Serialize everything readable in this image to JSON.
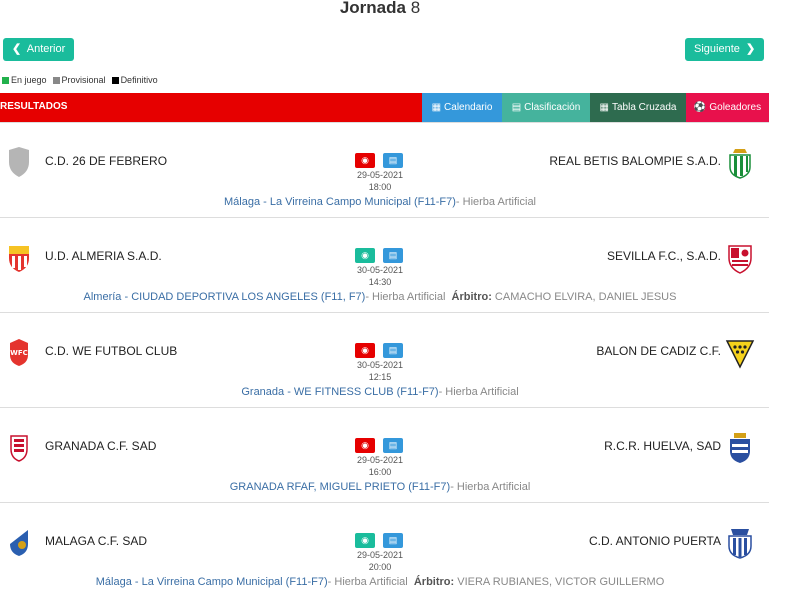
{
  "header": {
    "title_word": "Jornada",
    "title_num": "8"
  },
  "nav": {
    "prev_label": "Anterior",
    "next_label": "Siguiente"
  },
  "legend": [
    {
      "label": "En juego",
      "color": "#22b14c"
    },
    {
      "label": "Provisional",
      "color": "#888888"
    },
    {
      "label": "Definitivo",
      "color": "#000000"
    }
  ],
  "tabs": {
    "section_label": "RESULTADOS",
    "calendario": "Calendario",
    "clasificacion": "Clasificación",
    "tabla": "Tabla Cruzada",
    "goleadores": "Goleadores"
  },
  "matches": [
    {
      "home": "C.D. 26 DE FEBRERO",
      "away": "REAL BETIS BALOMPIE S.A.D.",
      "status": "red",
      "date": "29-05-2021",
      "time": "18:00",
      "location": "Málaga - La Virreina Campo Municipal (F11-F7)",
      "surface": "- Hierba Artificial",
      "ref_label": "",
      "referee": "",
      "home_crest": "shield-gray",
      "away_crest": "betis-crest"
    },
    {
      "home": "U.D. ALMERIA S.A.D.",
      "away": "SEVILLA F.C., S.A.D.",
      "status": "green",
      "date": "30-05-2021",
      "time": "14:30",
      "location": "Almería - CIUDAD DEPORTIVA LOS ANGELES (F11, F7)",
      "surface": "- Hierba Artificial",
      "ref_label": "Árbitro:",
      "referee": "CAMACHO ELVIRA, DANIEL JESUS",
      "home_crest": "almeria-crest",
      "away_crest": "sevilla-crest"
    },
    {
      "home": "C.D. WE FUTBOL CLUB",
      "away": "BALON DE CADIZ C.F.",
      "status": "red",
      "date": "30-05-2021",
      "time": "12:15",
      "location": "Granada - WE FITNESS CLUB (F11-F7)",
      "surface": "- Hierba Artificial",
      "ref_label": "",
      "referee": "",
      "home_crest": "wefc-crest",
      "away_crest": "cadiz-crest"
    },
    {
      "home": "GRANADA C.F. SAD",
      "away": "R.C.R. HUELVA, SAD",
      "status": "red",
      "date": "29-05-2021",
      "time": "16:00",
      "location": "GRANADA RFAF, MIGUEL PRIETO (F11-F7)",
      "surface": "- Hierba Artificial",
      "ref_label": "",
      "referee": "",
      "home_crest": "granada-crest",
      "away_crest": "huelva-crest"
    },
    {
      "home": "MALAGA C.F. SAD",
      "away": "C.D. ANTONIO PUERTA",
      "status": "green",
      "date": "29-05-2021",
      "time": "20:00",
      "location": "Málaga - La Virreina Campo Municipal (F11-F7)",
      "surface": "- Hierba Artificial",
      "ref_label": "Árbitro:",
      "referee": "VIERA RUBIANES, VICTOR GUILLERMO",
      "home_crest": "malaga-crest",
      "away_crest": "antonio-puerta-crest"
    }
  ]
}
